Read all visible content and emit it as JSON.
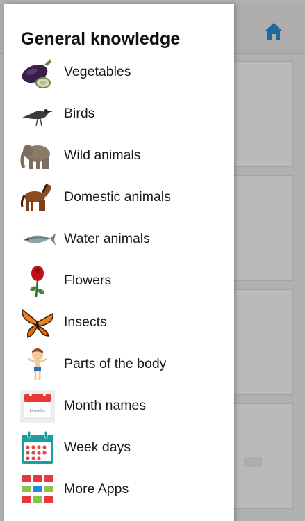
{
  "drawer": {
    "title": "General knowledge",
    "items": [
      {
        "label": "Vegetables",
        "icon": "eggplant-icon"
      },
      {
        "label": "Birds",
        "icon": "crow-icon"
      },
      {
        "label": "Wild animals",
        "icon": "elephant-icon"
      },
      {
        "label": "Domestic animals",
        "icon": "horse-icon"
      },
      {
        "label": "Water animals",
        "icon": "fish-icon"
      },
      {
        "label": "Flowers",
        "icon": "rose-icon"
      },
      {
        "label": "Insects",
        "icon": "butterfly-icon"
      },
      {
        "label": "Parts of the body",
        "icon": "boy-icon"
      },
      {
        "label": "Month names",
        "icon": "calendar-icon",
        "icon_text": "Months"
      },
      {
        "label": "Week days",
        "icon": "week-calendar-icon"
      },
      {
        "label": "More Apps",
        "icon": "apps-grid-icon"
      }
    ]
  },
  "header": {
    "home_icon": "home-icon"
  },
  "colors": {
    "home": "#2a8fd6",
    "calendar_red": "#e53935",
    "calendar_teal": "#1a9ea0",
    "apps_red": "#e8383d",
    "apps_green": "#8bc34a",
    "apps_blue": "#1e88e5"
  }
}
